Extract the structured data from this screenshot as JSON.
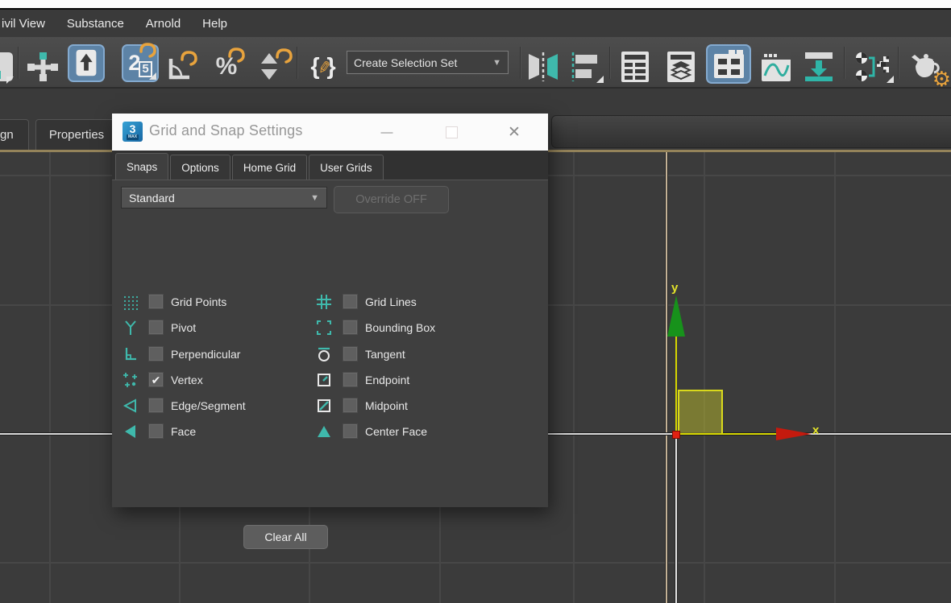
{
  "glyphs": {
    "dropdown_arrow": "▼",
    "close": "✕",
    "minimize": "—",
    "check": "✔",
    "pencil": "✎",
    "gear": "⚙",
    "percent": "%",
    "brace_open": "{",
    "brace_close": "}"
  },
  "colors": {
    "accent_teal": "#3fb9ac",
    "accent_yellow": "#e8a33d",
    "selection_blue": "#5d83a6",
    "axis_x_red": "#c41a0e",
    "axis_y_green": "#17921b",
    "gizmo_yellow": "#d6d600",
    "viewport_bg": "#3b3b3b"
  },
  "menu_bar": {
    "items": [
      "ivil View",
      "Substance",
      "Arnold",
      "Help"
    ]
  },
  "toolbar": {
    "selection_set_label": "Create Selection Set",
    "snap_major": "2",
    "snap_minor": "5",
    "icons": [
      "select-region",
      "select-and-move",
      "select-object",
      "snaps-toggle-2.5",
      "angle-snap-toggle",
      "percent-snap-toggle",
      "spinner-snap-toggle",
      "keyboard-shortcut-override",
      "create-selection-set",
      "mirror",
      "align",
      "scene-explorer",
      "layer-explorer",
      "ribbon-toggle",
      "curve-editor",
      "schematic-view",
      "material-editor",
      "render-setup"
    ]
  },
  "ribbon": {
    "tabs": [
      "lign",
      "Properties"
    ]
  },
  "dialog": {
    "title": "Grid and Snap Settings",
    "logo_text": "3",
    "logo_sub": "MAX",
    "tabs": [
      {
        "label": "Snaps",
        "active": true
      },
      {
        "label": "Options",
        "active": false
      },
      {
        "label": "Home Grid",
        "active": false
      },
      {
        "label": "User Grids",
        "active": false
      }
    ],
    "preset_value": "Standard",
    "override_label": "Override OFF",
    "clear_label": "Clear All",
    "snap_items": [
      {
        "label": "Grid Points",
        "icon": "grid-points",
        "checked": false
      },
      {
        "label": "Grid Lines",
        "icon": "grid-lines",
        "checked": false
      },
      {
        "label": "Pivot",
        "icon": "pivot",
        "checked": false
      },
      {
        "label": "Bounding Box",
        "icon": "bounding-box",
        "checked": false
      },
      {
        "label": "Perpendicular",
        "icon": "perpendicular",
        "checked": false
      },
      {
        "label": "Tangent",
        "icon": "tangent",
        "checked": false
      },
      {
        "label": "Vertex",
        "icon": "vertex",
        "checked": true
      },
      {
        "label": "Endpoint",
        "icon": "endpoint",
        "checked": false
      },
      {
        "label": "Edge/Segment",
        "icon": "edge-segment",
        "checked": false
      },
      {
        "label": "Midpoint",
        "icon": "midpoint",
        "checked": false
      },
      {
        "label": "Face",
        "icon": "face",
        "checked": false
      },
      {
        "label": "Center Face",
        "icon": "center-face",
        "checked": false
      }
    ]
  },
  "viewport": {
    "axis_x_label": "x",
    "axis_y_label": "y"
  }
}
